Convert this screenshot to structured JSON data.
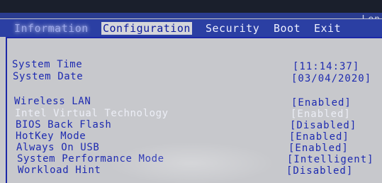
{
  "brand": "Len",
  "menu": {
    "tabs": [
      {
        "label": "Information"
      },
      {
        "label": "Configuration"
      },
      {
        "label": "Security"
      },
      {
        "label": "Boot"
      },
      {
        "label": "Exit"
      }
    ]
  },
  "settings": [
    {
      "label": "System Time",
      "value": "[11:14:37]"
    },
    {
      "label": "System Date",
      "value": "[03/04/2020]"
    },
    {
      "label": "Wireless LAN",
      "value": "[Enabled]"
    },
    {
      "label": "Intel Virtual Technology",
      "value": "[Enabled]"
    },
    {
      "label": "BIOS Back Flash",
      "value": "[Disabled]"
    },
    {
      "label": "HotKey Mode",
      "value": "[Enabled]"
    },
    {
      "label": "Always On USB",
      "value": "[Enabled]"
    },
    {
      "label": "System Performance Mode",
      "value": "[Intelligent]"
    },
    {
      "label": "Workload Hint",
      "value": "[Disabled]"
    }
  ],
  "colors": {
    "menu_bar": "#2b3fa3",
    "panel_background": "#c7c8cc",
    "text_blue": "#1d2ab0",
    "highlighted_text": "#eceef6"
  }
}
